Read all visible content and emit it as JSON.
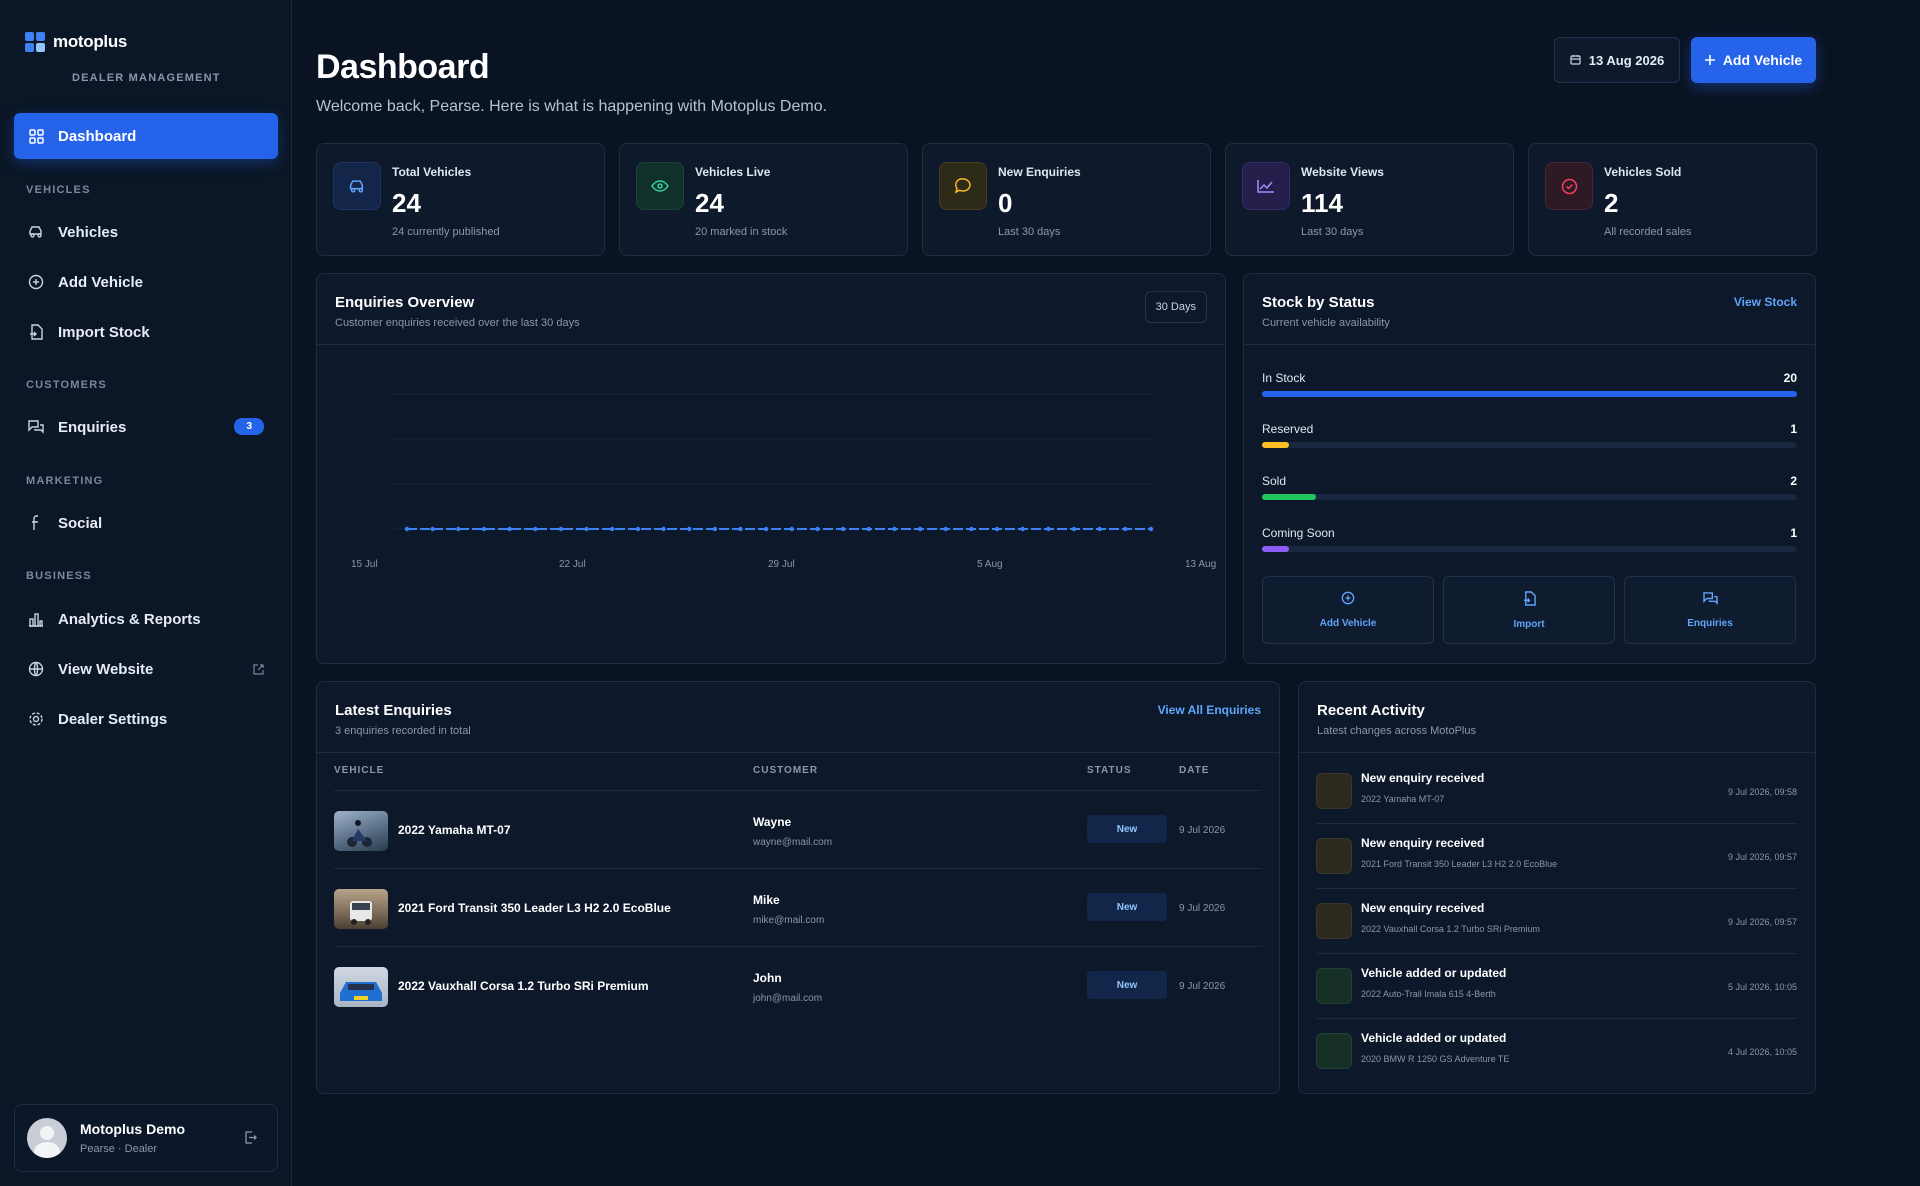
{
  "brand": {
    "name": "motoplus",
    "subtitle": "DEALER MANAGEMENT"
  },
  "sidebar": {
    "active": {
      "label": "Dashboard",
      "icon": "grid-icon"
    },
    "sections": [
      {
        "title": "VEHICLES"
      },
      {
        "title": "CUSTOMERS"
      },
      {
        "title": "MARKETING"
      },
      {
        "title": "BUSINESS"
      }
    ],
    "items": [
      {
        "label": "Vehicles",
        "icon": "car-icon"
      },
      {
        "label": "Add Vehicle",
        "icon": "plus-circle-icon"
      },
      {
        "label": "Import Stock",
        "icon": "file-import-icon"
      },
      {
        "label": "Enquiries",
        "icon": "chat-icon",
        "badge": "3"
      },
      {
        "label": "Social",
        "icon": "facebook-icon"
      },
      {
        "label": "Analytics & Reports",
        "icon": "bar-chart-icon"
      },
      {
        "label": "View Website",
        "icon": "globe-icon"
      },
      {
        "label": "Dealer Settings",
        "icon": "gear-icon"
      }
    ],
    "user": {
      "name": "Motoplus Demo",
      "role": "Pearse · Dealer"
    }
  },
  "header": {
    "title": "Dashboard",
    "welcome": "Welcome back, Pearse. Here is what is happening with Motoplus Demo.",
    "date": "13 Aug 2026",
    "add_label": "Add Vehicle"
  },
  "stats": [
    {
      "label": "Total Vehicles",
      "value": "24",
      "sub": "24 currently published",
      "color": "#3b82f6"
    },
    {
      "label": "Vehicles Live",
      "value": "24",
      "sub": "20 marked in stock",
      "color": "#34d399"
    },
    {
      "label": "New Enquiries",
      "value": "0",
      "sub": "Last 30 days",
      "color": "#fbbf24"
    },
    {
      "label": "Website Views",
      "value": "114",
      "sub": "Last 30 days",
      "color": "#8b5cf6"
    },
    {
      "label": "Vehicles Sold",
      "value": "2",
      "sub": "All recorded sales",
      "color": "#f43f5e"
    }
  ],
  "enquiries_overview": {
    "title": "Enquiries Overview",
    "subtitle": "Customer enquiries received over the last 30 days",
    "range": "30 Days"
  },
  "chart_data": {
    "type": "line",
    "x_ticks": [
      "15 Jul",
      "22 Jul",
      "29 Jul",
      "5 Aug",
      "13 Aug"
    ],
    "series": [
      {
        "values": [
          0,
          0,
          0,
          0,
          0,
          0,
          0,
          0,
          0,
          0,
          0,
          0,
          0,
          0,
          0,
          0,
          0,
          0,
          0,
          0,
          0,
          0,
          0,
          0,
          0,
          0,
          0,
          0,
          0,
          0
        ]
      }
    ],
    "color": "#3b82f6"
  },
  "stock": {
    "title": "Stock by Status",
    "subtitle": "Current vehicle availability",
    "link": "View Stock",
    "rows": [
      {
        "label": "In Stock",
        "value": "20",
        "fraction": 1.0,
        "color": "#2563eb"
      },
      {
        "label": "Reserved",
        "value": "1",
        "fraction": 0.05,
        "color": "#fbbf24"
      },
      {
        "label": "Sold",
        "value": "2",
        "fraction": 0.1,
        "color": "#22c55e"
      },
      {
        "label": "Coming Soon",
        "value": "1",
        "fraction": 0.05,
        "color": "#8b5cf6"
      }
    ],
    "actions": [
      {
        "label": "Add Vehicle",
        "icon": "plus-circle-icon"
      },
      {
        "label": "Import",
        "icon": "file-import-icon"
      },
      {
        "label": "Enquiries",
        "icon": "chat-icon"
      }
    ]
  },
  "latest": {
    "title": "Latest Enquiries",
    "subtitle": "3 enquiries recorded in total",
    "link": "View All Enquiries",
    "headers": [
      "VEHICLE",
      "CUSTOMER",
      "STATUS",
      "DATE"
    ],
    "rows": [
      {
        "vehicle": "2022 Yamaha MT-07",
        "customer": "Wayne",
        "email": "wayne@mail.com",
        "status": "New",
        "date": "9 Jul 2026"
      },
      {
        "vehicle": "2021 Ford Transit 350 Leader L3 H2 2.0 EcoBlue",
        "customer": "Mike",
        "email": "mike@mail.com",
        "status": "New",
        "date": "9 Jul 2026"
      },
      {
        "vehicle": "2022 Vauxhall Corsa 1.2 Turbo SRi Premium",
        "customer": "John",
        "email": "john@mail.com",
        "status": "New",
        "date": "9 Jul 2026"
      }
    ]
  },
  "activity": {
    "title": "Recent Activity",
    "subtitle": "Latest changes across MotoPlus",
    "items": [
      {
        "title": "New enquiry received",
        "sub": "2022 Yamaha MT-07",
        "time": "9 Jul 2026, 09:58"
      },
      {
        "title": "New enquiry received",
        "sub": "2021 Ford Transit 350 Leader L3 H2 2.0 EcoBlue",
        "time": "9 Jul 2026, 09:57"
      },
      {
        "title": "New enquiry received",
        "sub": "2022 Vauxhall Corsa 1.2 Turbo SRi Premium",
        "time": "9 Jul 2026, 09:57"
      },
      {
        "title": "Vehicle added or updated",
        "sub": "2022 Auto-Trail Imala 615 4-Berth",
        "time": "5 Jul 2026, 10:05"
      },
      {
        "title": "Vehicle added or updated",
        "sub": "2020 BMW R 1250 GS Adventure TE",
        "time": "4 Jul 2026, 10:05"
      }
    ]
  }
}
